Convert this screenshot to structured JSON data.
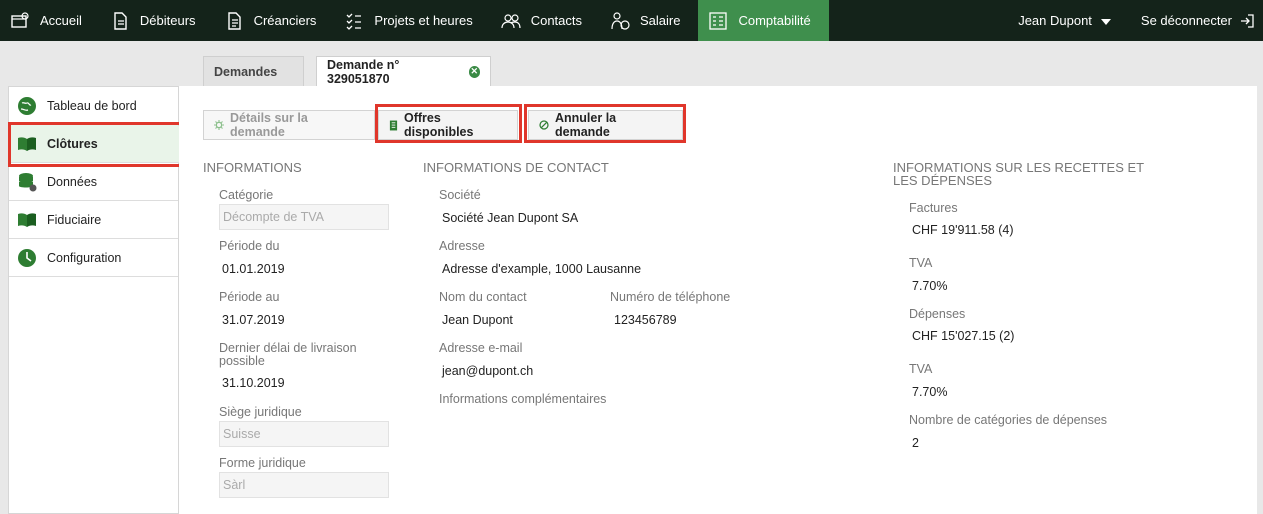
{
  "nav": {
    "items": [
      {
        "label": "Accueil",
        "icon": "home-icon"
      },
      {
        "label": "Débiteurs",
        "icon": "document-icon"
      },
      {
        "label": "Créanciers",
        "icon": "document-icon"
      },
      {
        "label": "Projets et heures",
        "icon": "checklist-icon"
      },
      {
        "label": "Contacts",
        "icon": "people-icon"
      },
      {
        "label": "Salaire",
        "icon": "salary-icon"
      },
      {
        "label": "Comptabilité",
        "icon": "ledger-icon"
      }
    ],
    "active": "Comptabilité",
    "user": "Jean Dupont",
    "logout": "Se déconnecter"
  },
  "tabs": [
    {
      "label": "Demandes"
    },
    {
      "label": "Demande n° 329051870"
    }
  ],
  "sidebar": {
    "items": [
      {
        "label": "Tableau de bord",
        "icon": "globe-icon"
      },
      {
        "label": "Clôtures",
        "icon": "book-icon"
      },
      {
        "label": "Données",
        "icon": "database-icon"
      },
      {
        "label": "Fiduciaire",
        "icon": "book-icon"
      },
      {
        "label": "Configuration",
        "icon": "clock-icon"
      }
    ],
    "active": "Clôtures"
  },
  "actions": {
    "details": "Détails sur la demande",
    "offers": "Offres disponibles",
    "cancel": "Annuler la demande"
  },
  "info": {
    "title": "INFORMATIONS",
    "category_label": "Catégorie",
    "category": "Décompte de TVA",
    "period_from_label": "Période du",
    "period_from": "01.01.2019",
    "period_to_label": "Période au",
    "period_to": "31.07.2019",
    "deadline_label": "Dernier délai de livraison possible",
    "deadline": "31.10.2019",
    "seat_label": "Siège juridique",
    "seat": "Suisse",
    "form_label": "Forme juridique",
    "form": "Sàrl"
  },
  "contact": {
    "title": "INFORMATIONS DE CONTACT",
    "company_label": "Société",
    "company": "Société Jean Dupont SA",
    "address_label": "Adresse",
    "address": "Adresse d'example, 1000 Lausanne",
    "name_label": "Nom du contact",
    "name": "Jean Dupont",
    "phone_label": "Numéro de téléphone",
    "phone": "123456789",
    "email_label": "Adresse e-mail",
    "email": "jean@dupont.ch",
    "extra_label": "Informations complémentaires"
  },
  "finance": {
    "title": "INFORMATIONS SUR LES RECETTES ET LES DÉPENSES",
    "invoices_label": "Factures",
    "invoices": "CHF 19'911.58 (4)",
    "vat1_label": "TVA",
    "vat1": "7.70%",
    "expenses_label": "Dépenses",
    "expenses": "CHF 15'027.15 (2)",
    "vat2_label": "TVA",
    "vat2": "7.70%",
    "categories_label": "Nombre de catégories de dépenses",
    "categories": "2"
  },
  "colors": {
    "nav_bg": "#14231a",
    "accent": "#3f8f4d",
    "highlight": "#e0362b"
  }
}
